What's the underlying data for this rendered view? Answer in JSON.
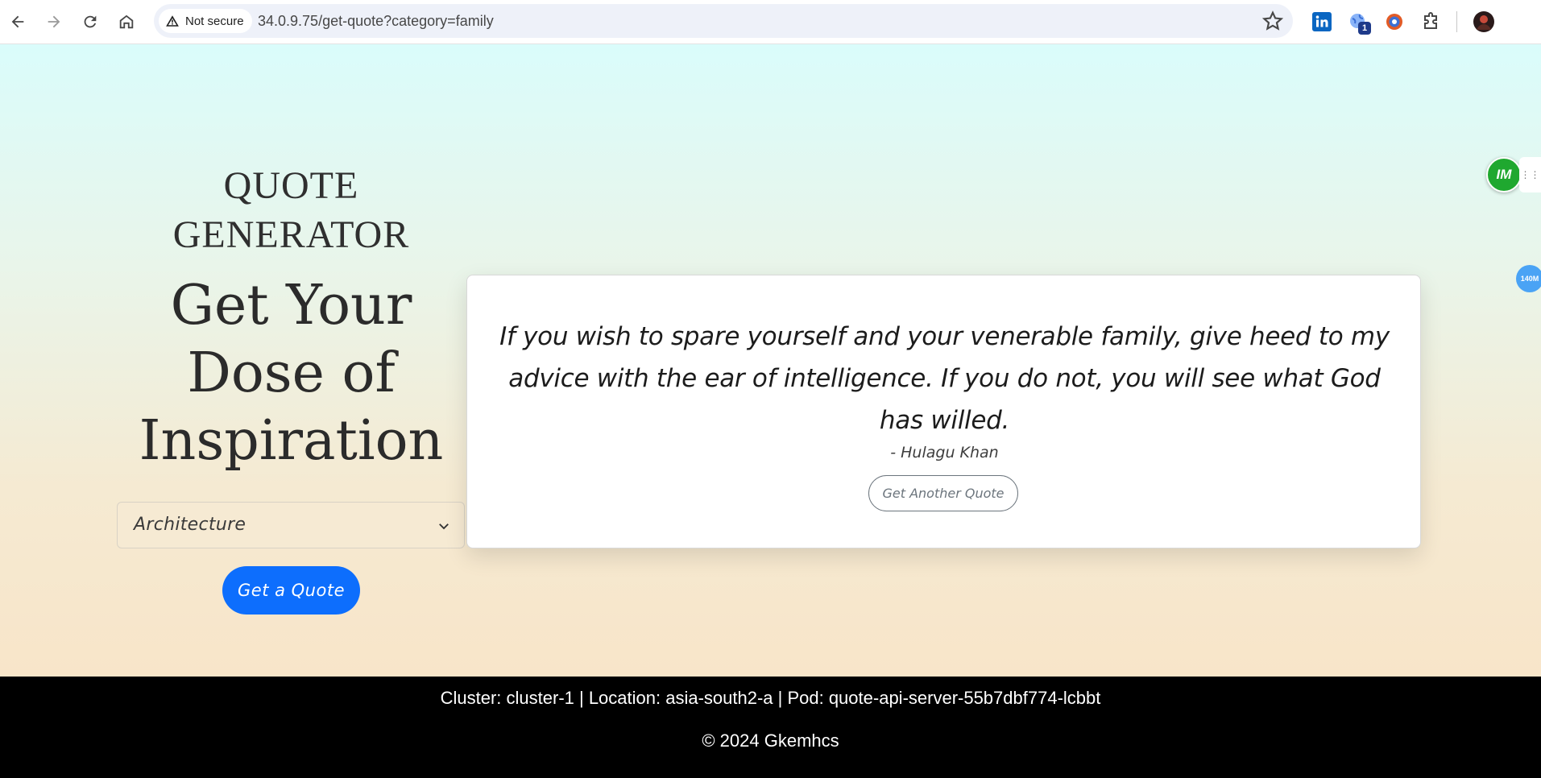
{
  "browser": {
    "security_label": "Not secure",
    "url": "34.0.9.75/get-quote?category=family",
    "icons": [
      "back-arrow-icon",
      "forward-arrow-icon",
      "reload-icon",
      "home-icon",
      "warning-triangle-icon",
      "bookmark-star-icon",
      "linkedin-icon",
      "globe-extension-icon",
      "extension-orange-icon",
      "puzzle-extensions-icon",
      "profile-avatar-icon"
    ],
    "extension_badge_count": "1"
  },
  "hero": {
    "site_title": "QUOTE GENERATOR",
    "heading": "Get Your Dose of Inspiration"
  },
  "controls": {
    "category_selected": "Architecture",
    "get_quote_label": "Get a Quote"
  },
  "quote": {
    "text": "If you wish to spare yourself and your venerable family, give heed to my advice with the ear of intelligence. If you do not, you will see what God has willed.",
    "author": "- Hulagu Khan",
    "another_label": "Get Another Quote"
  },
  "overlays": {
    "im_badge_label": "IM",
    "speed_badge_label": "140M"
  },
  "footer": {
    "cluster_info": "Cluster: cluster-1 | Location: asia-south2-a | Pod: quote-api-server-55b7dbf774-lcbbt",
    "copyright": "© 2024 Gkemhcs"
  },
  "colors": {
    "primary_button": "#0d6efd",
    "footer_bg": "#000000",
    "gradient_top": "#dafcfb",
    "gradient_bottom": "#f8e5c9"
  }
}
